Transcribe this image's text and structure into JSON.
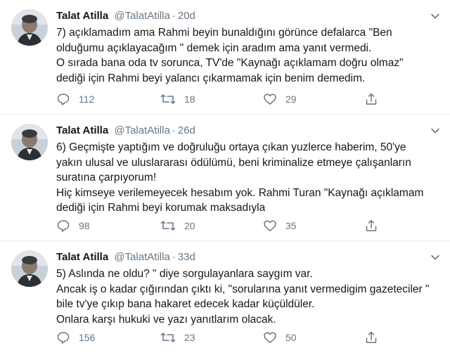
{
  "tweets": [
    {
      "author": "Talat Atilla",
      "handle": "@TalatAtilla",
      "separator": "·",
      "time": "20d",
      "lines": [
        "7) açıklamadım ama Rahmi beyin bunaldığını görünce defalarca \"Ben",
        "olduğumu açıklayacağım \" demek için aradım ama yanıt vermedi.",
        "O sırada bana oda tv sorunca, TV'de \"Kaynağı açıklamam doğru olmaz\"",
        "dediği için Rahmi beyi yalancı çıkarmamak için benim demedim."
      ],
      "replies": "112",
      "retweets": "18",
      "likes": "29"
    },
    {
      "author": "Talat Atilla",
      "handle": "@TalatAtilla",
      "separator": "·",
      "time": "26d",
      "lines": [
        "6) Geçmişte yaptığım ve doğruluğu ortaya çıkan yuzlerce haberim, 50'ye",
        "yakın ulusal ve uluslararası ödülümü, beni kriminalize etmeye çalışanların",
        "suratına çarpıyorum!",
        "Hiç kimseye verilemeyecek hesabım yok. Rahmi Turan \"Kaynağı açıklamam",
        "dediği için Rahmi beyi korumak maksadıyla"
      ],
      "replies": "98",
      "retweets": "20",
      "likes": "35"
    },
    {
      "author": "Talat Atilla",
      "handle": "@TalatAtilla",
      "separator": "·",
      "time": "33d",
      "lines": [
        "5) Aslında ne oldu? \" diye sorgulayanlara saygım var.",
        "Ancak iş o kadar çığırından çıktı ki, \"sorularına yanıt vermedigim gazeteciler \"",
        "bile tv'ye çıkıp bana hakaret edecek  kadar küçüldüler.",
        "Onlara karşı hukuki ve yazı yanıtlarım olacak."
      ],
      "replies": "156",
      "retweets": "23",
      "likes": "50"
    }
  ],
  "colors": {
    "text": "#14171a",
    "secondary": "#657786",
    "divider": "#e6ecf0"
  },
  "icons": [
    "avatar",
    "chevron-down-icon",
    "reply-icon",
    "retweet-icon",
    "like-icon",
    "share-icon"
  ]
}
